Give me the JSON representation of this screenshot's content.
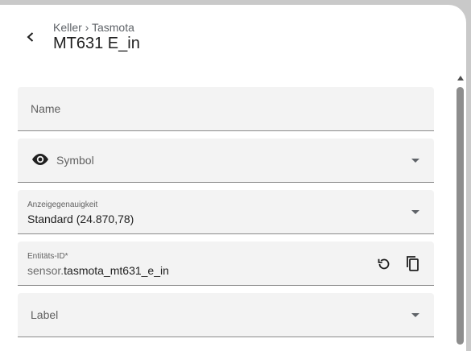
{
  "header": {
    "back_icon": "chevron-left-icon",
    "breadcrumb": "Keller › Tasmota",
    "title": "MT631 E_in"
  },
  "fields": {
    "name": {
      "placeholder": "Name"
    },
    "symbol": {
      "placeholder": "Symbol",
      "icon": "eye-icon"
    },
    "precision": {
      "label": "Anzeigegenauigkeit",
      "value": "Standard (24.870,78)"
    },
    "entity_id": {
      "label": "Entitäts-ID*",
      "prefix": "sensor.",
      "value": "tasmota_mt631_e_in",
      "reset_icon": "restore-icon",
      "copy_icon": "copy-icon"
    },
    "label": {
      "placeholder": "Label"
    }
  },
  "colors": {
    "field_bg": "#f3f3f3",
    "text_primary": "#1f1f1f",
    "text_secondary": "#616161",
    "backdrop": "#c9c9c9"
  }
}
